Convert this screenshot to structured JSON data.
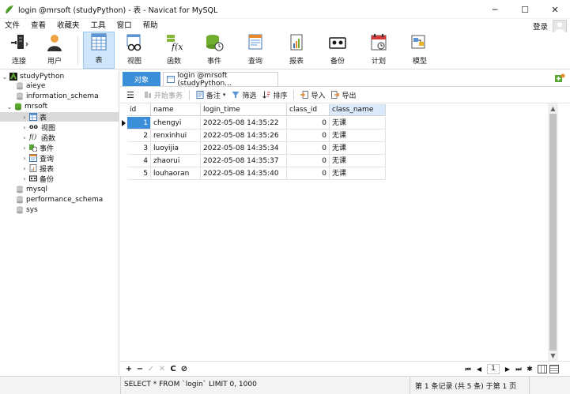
{
  "window": {
    "title": "login @mrsoft (studyPython) - 表 - Navicat for MySQL",
    "minimize_glyph": "─",
    "maximize_glyph": "☐",
    "close_glyph": "✕"
  },
  "menu": {
    "items": [
      "文件",
      "查看",
      "收藏夹",
      "工具",
      "窗口",
      "帮助"
    ],
    "login_label": "登录"
  },
  "toolbar": {
    "tools": [
      {
        "label": "连接",
        "icon": "connection-icon"
      },
      {
        "label": "用户",
        "icon": "user-icon"
      },
      {
        "label": "表",
        "icon": "table-icon"
      },
      {
        "label": "视图",
        "icon": "view-icon"
      },
      {
        "label": "函数",
        "icon": "function-icon"
      },
      {
        "label": "事件",
        "icon": "event-icon"
      },
      {
        "label": "查询",
        "icon": "query-icon"
      },
      {
        "label": "报表",
        "icon": "report-icon"
      },
      {
        "label": "备份",
        "icon": "backup-icon"
      },
      {
        "label": "计划",
        "icon": "schedule-icon"
      },
      {
        "label": "模型",
        "icon": "model-icon"
      }
    ],
    "active": "表"
  },
  "tree": {
    "connection": "studyPython",
    "databases": [
      "aieye",
      "information_schema",
      "mrsoft",
      "mysql",
      "performance_schema",
      "sys"
    ],
    "mrsoft_children": [
      "表",
      "视图",
      "函数",
      "事件",
      "查询",
      "报表",
      "备份"
    ],
    "function_prefix": "f()",
    "view_prefix": "oo"
  },
  "tabs": {
    "objects": "对象",
    "table_tab": "login @mrsoft (studyPython..."
  },
  "table_toolbar": {
    "menu_glyph": "☰",
    "begin_transaction": "开始事务",
    "memo": "备注",
    "filter": "筛选",
    "sort": "排序",
    "import": "导入",
    "export": "导出",
    "dropdown_glyph": "▾"
  },
  "grid": {
    "columns": [
      "id",
      "name",
      "login_time",
      "class_id",
      "class_name"
    ],
    "rows": [
      {
        "id": "1",
        "name": "chengyi",
        "login_time": "2022-05-08 14:35:22",
        "class_id": "0",
        "class_name": "无课"
      },
      {
        "id": "2",
        "name": "renxinhui",
        "login_time": "2022-05-08 14:35:26",
        "class_id": "0",
        "class_name": "无课"
      },
      {
        "id": "3",
        "name": "luoyijia",
        "login_time": "2022-05-08 14:35:34",
        "class_id": "0",
        "class_name": "无课"
      },
      {
        "id": "4",
        "name": "zhaorui",
        "login_time": "2022-05-08 14:35:37",
        "class_id": "0",
        "class_name": "无课"
      },
      {
        "id": "5",
        "name": "louhaoran",
        "login_time": "2022-05-08 14:35:40",
        "class_id": "0",
        "class_name": "无课"
      }
    ],
    "scroll_up": "▲",
    "scroll_down": "▼"
  },
  "navbar": {
    "add": "+",
    "delete": "−",
    "apply": "✓",
    "cancel": "✕",
    "refresh": "C",
    "stop": "⊘",
    "first": "⏮",
    "prev": "◀",
    "page": "1",
    "next": "▶",
    "last": "⏭",
    "settings": "✱"
  },
  "status": {
    "sql": "SELECT * FROM `login` LIMIT 0, 1000",
    "records": "第 1 条记录 (共 5 条) 于第 1 页"
  },
  "colors": {
    "accent": "#3b8ed8",
    "selection": "#3b8ed8",
    "active_tool_bg": "#cfe5fa"
  }
}
